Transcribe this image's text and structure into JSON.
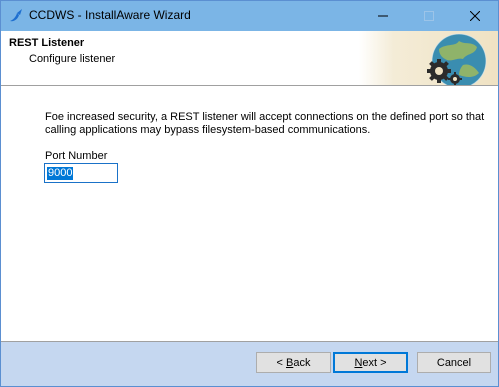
{
  "window": {
    "title": "CCDWS - InstallAware Wizard",
    "app_icon": "installaware-swoosh-icon",
    "controls": {
      "minimize": "minimize-icon",
      "maximize": "maximize-icon",
      "close": "close-icon"
    }
  },
  "header": {
    "title": "REST Listener",
    "subtitle": "Configure listener",
    "graphic": "globe-gears-icon"
  },
  "body": {
    "description": "Foe increased security, a REST listener will accept connections on the defined port so that calling applications may bypass filesystem-based communications.",
    "port_label": "Port Number",
    "port_value": "9000"
  },
  "footer": {
    "back_prefix": "< ",
    "back_mnemonic": "B",
    "back_rest": "ack",
    "next_mnemonic": "N",
    "next_rest": "ext >",
    "cancel_label": "Cancel"
  },
  "colors": {
    "titlebar": "#7bb5e6",
    "footer": "#c5d7f0",
    "selection": "#0078d7",
    "focus_border": "#1a72c8"
  }
}
